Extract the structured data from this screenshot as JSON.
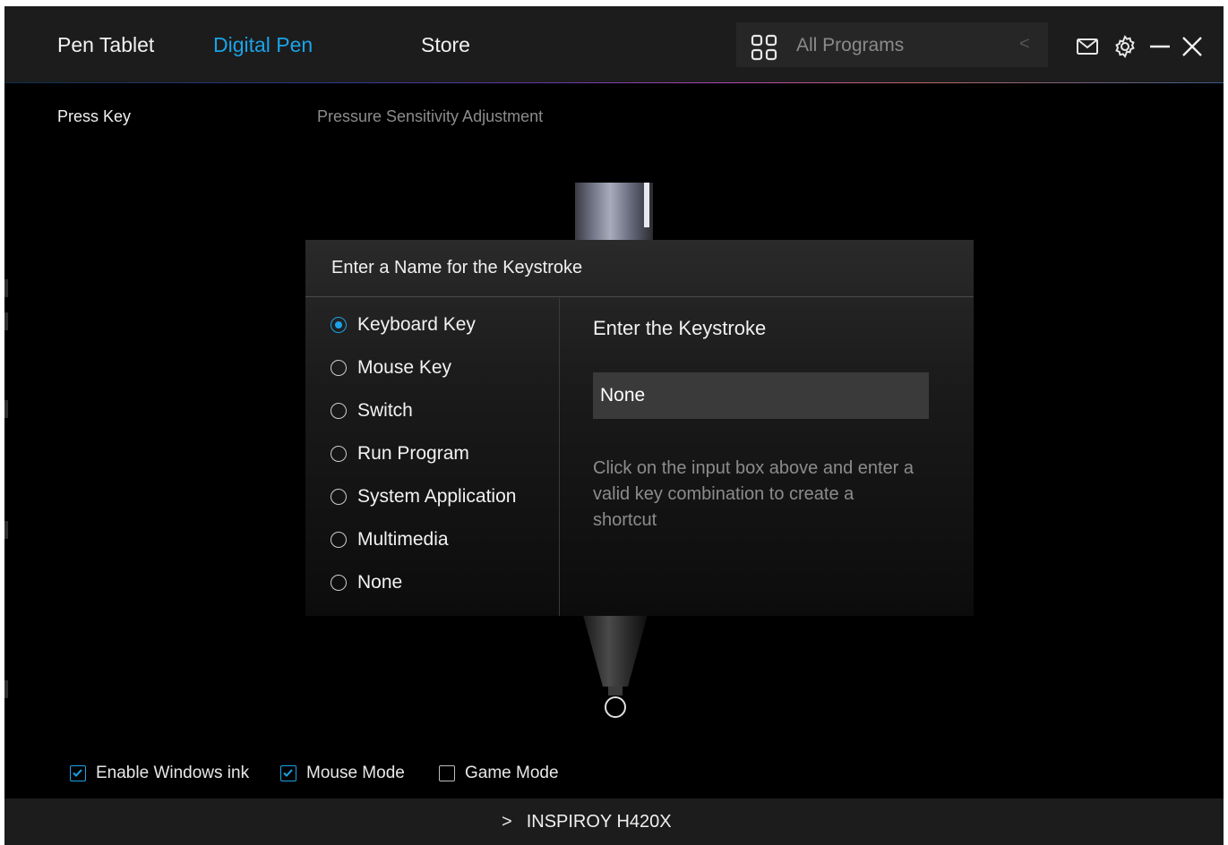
{
  "topbar": {
    "tabs": [
      {
        "label": "Pen Tablet",
        "active": false
      },
      {
        "label": "Digital Pen",
        "active": true
      },
      {
        "label": "Store",
        "active": false
      }
    ],
    "programs": {
      "label": "All Programs",
      "icon": "grid-icon",
      "back_glyph": "<"
    },
    "icons": [
      "mail-icon",
      "gear-icon",
      "minimize-icon",
      "close-icon"
    ]
  },
  "subtabs": {
    "press_key": "Press Key",
    "pressure": "Pressure Sensitivity Adjustment"
  },
  "dialog": {
    "title": "Enter a Name for the Keystroke",
    "options": [
      {
        "label": "Keyboard Key",
        "selected": true
      },
      {
        "label": "Mouse Key",
        "selected": false
      },
      {
        "label": "Switch",
        "selected": false
      },
      {
        "label": "Run Program",
        "selected": false
      },
      {
        "label": "System Application",
        "selected": false
      },
      {
        "label": "Multimedia",
        "selected": false
      },
      {
        "label": "None",
        "selected": false
      }
    ],
    "keystroke_heading": "Enter the Keystroke",
    "keystroke_value": "None",
    "help_text": "Click on the input box above and enter a valid key combination to create a shortcut"
  },
  "checkboxes": {
    "windows_ink": {
      "label": "Enable Windows ink",
      "checked": true
    },
    "mouse_mode": {
      "label": "Mouse Mode",
      "checked": true
    },
    "game_mode": {
      "label": "Game Mode",
      "checked": false
    }
  },
  "footer": {
    "chevron": ">",
    "device_name": "INSPIROY H420X"
  },
  "colors": {
    "accent": "#1aa3e8",
    "background": "#000000",
    "bar": "#1c1c1c"
  }
}
